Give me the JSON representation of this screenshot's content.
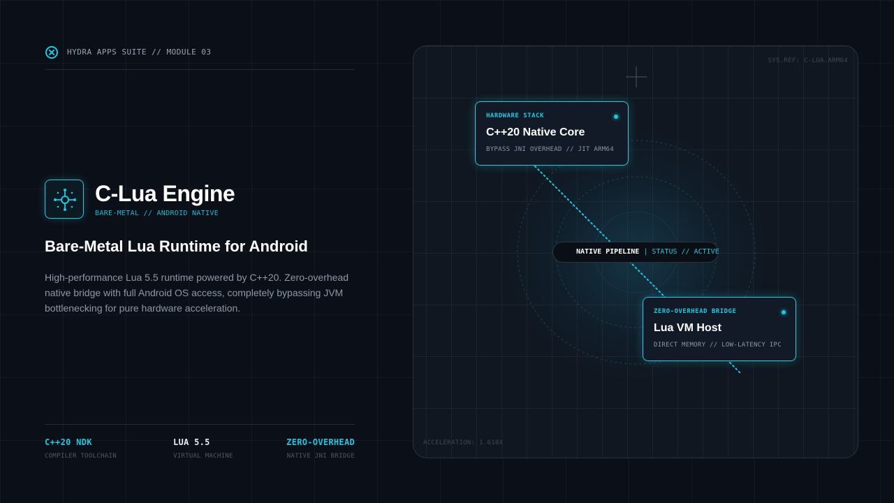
{
  "header": {
    "label": "HYDRA APPS SUITE // MODULE 03",
    "icon": "close-circle-icon"
  },
  "product": {
    "icon": "hub-node-icon",
    "title": "C-Lua Engine",
    "subtitle": "BARE-METAL // ANDROID NATIVE"
  },
  "headline": "Bare-Metal Lua Runtime for Android",
  "description": "High-performance Lua 5.5 runtime powered by C++20. Zero-overhead native bridge with full Android OS access, completely bypassing JVM bottlenecking for pure hardware acceleration.",
  "stats": [
    {
      "value": "C++20 NDK",
      "label": "COMPILER TOOLCHAIN"
    },
    {
      "value": "LUA 5.5",
      "label": "VIRTUAL MACHINE"
    },
    {
      "value": "ZERO-OVERHEAD",
      "label": "NATIVE JNI BRIDGE"
    }
  ],
  "panel": {
    "sysref": "SYS.REF: C-LUA.ARM64",
    "acceleration": "ACCELERATION: 1.618X",
    "card1": {
      "eyebrow": "HARDWARE STACK",
      "title": "C++20 Native Core",
      "meta": "BYPASS JNI OVERHEAD // JIT ARM64"
    },
    "card2": {
      "eyebrow": "ZERO-OVERHEAD BRIDGE",
      "title": "Lua VM Host",
      "meta": "DIRECT MEMORY // LOW-LATENCY IPC"
    },
    "pill": {
      "primary": "NATIVE PIPELINE",
      "secondary": "| STATUS // ACTIVE"
    }
  },
  "colors": {
    "accent": "#22c6e0",
    "background": "#0b0f18",
    "panel": "#101721"
  }
}
